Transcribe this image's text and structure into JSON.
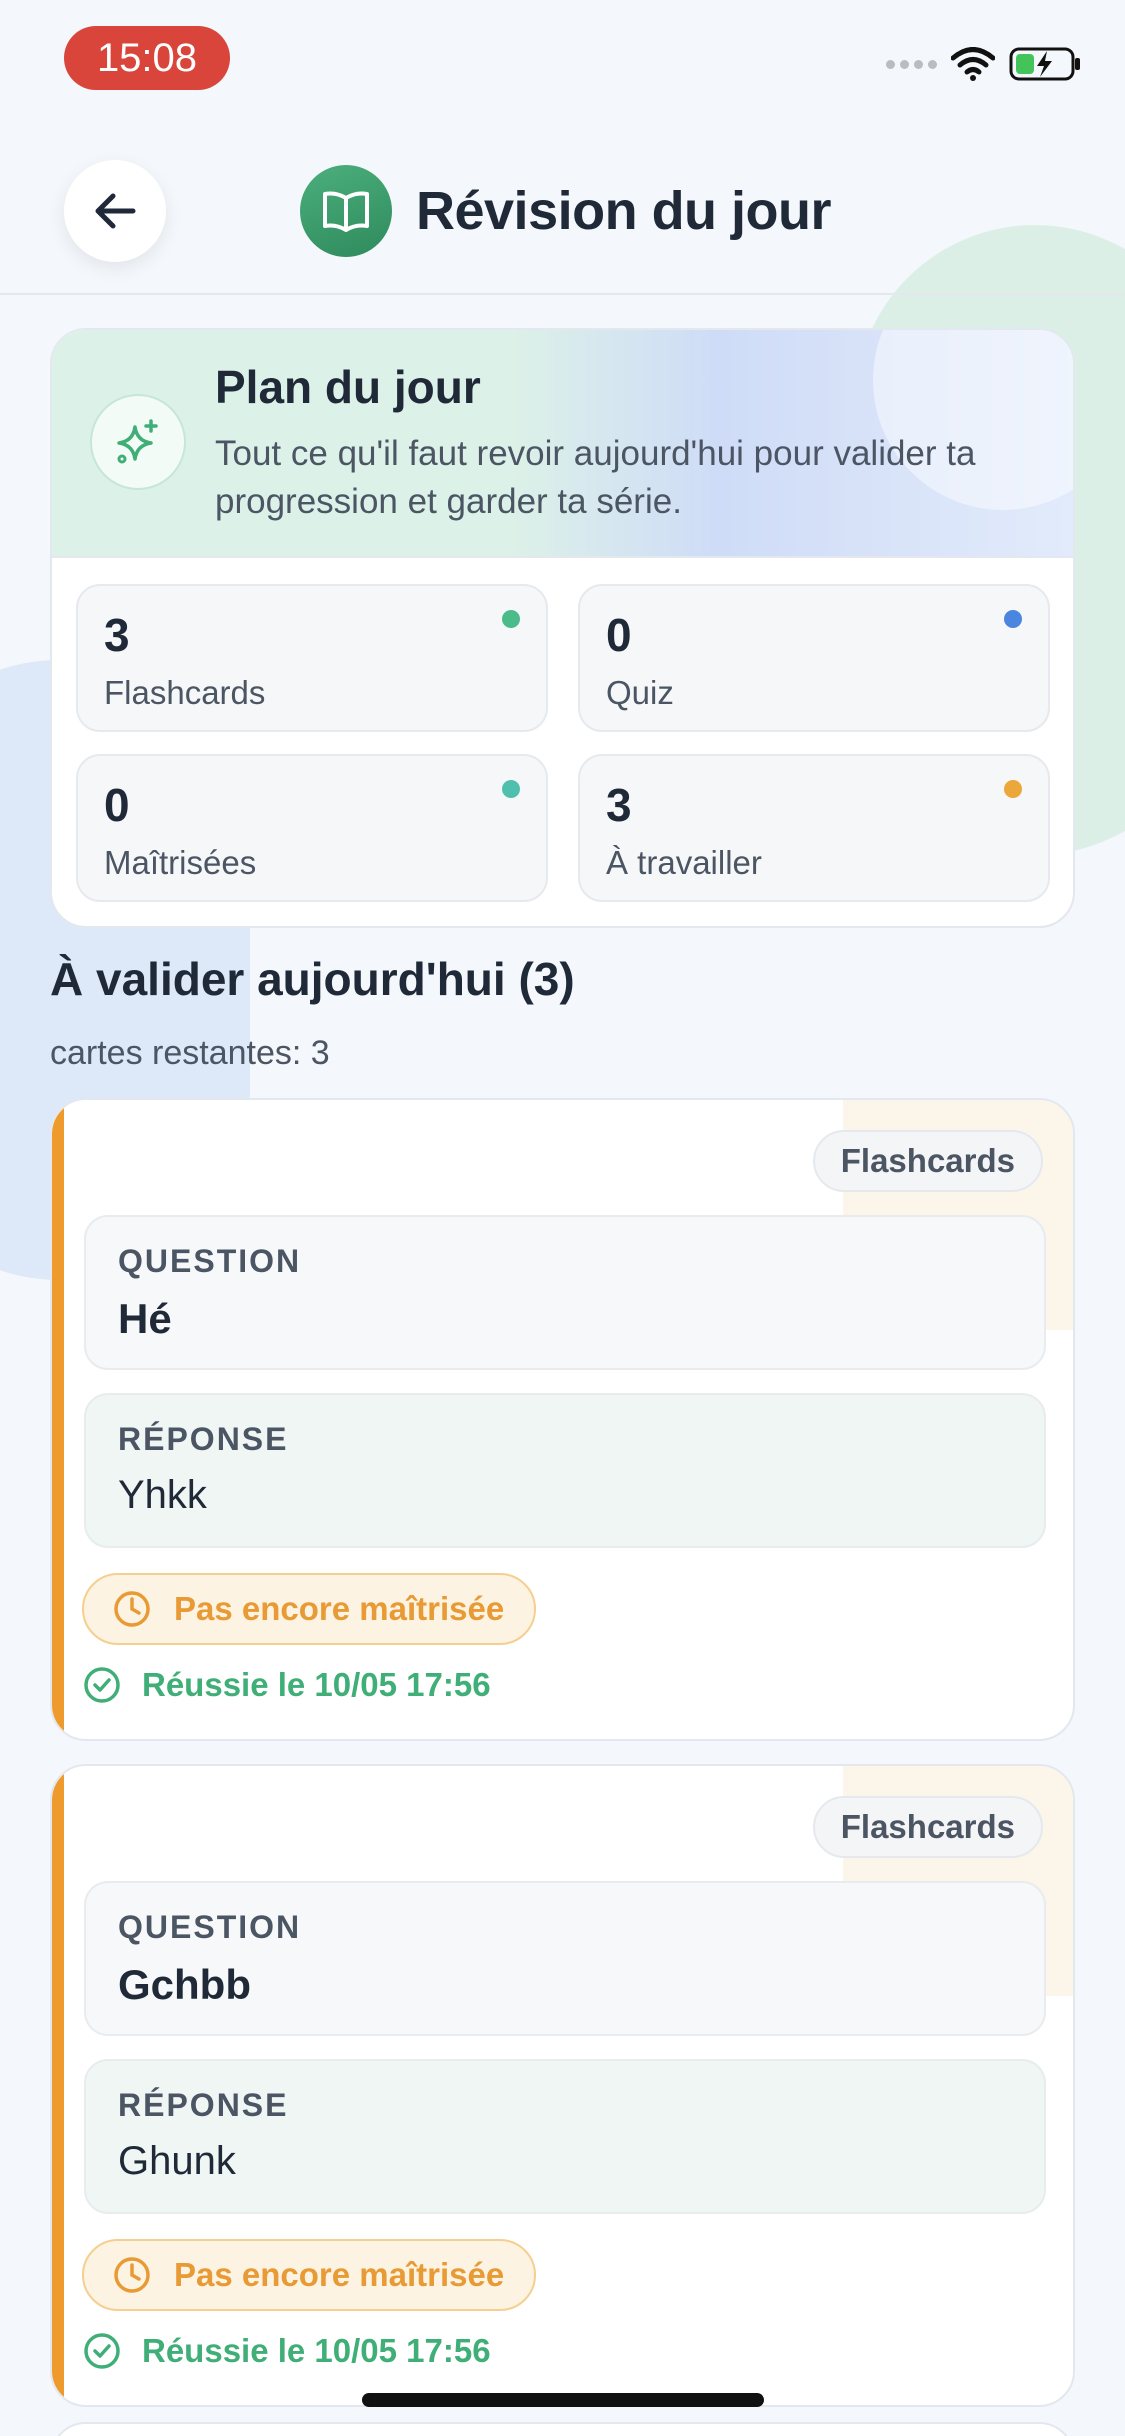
{
  "status_bar": {
    "time": "15:08"
  },
  "header": {
    "title": "Révision du jour"
  },
  "plan": {
    "title": "Plan du jour",
    "description": "Tout ce qu'il faut revoir aujourd'hui pour valider ta progression et garder ta série.",
    "stats": [
      {
        "value": "3",
        "label": "Flashcards",
        "dot_color": "#4cbb8a"
      },
      {
        "value": "0",
        "label": "Quiz",
        "dot_color": "#4a86e0"
      },
      {
        "value": "0",
        "label": "Maîtrisées",
        "dot_color": "#4fbfae"
      },
      {
        "value": "3",
        "label": "À travailler",
        "dot_color": "#eba73a"
      }
    ]
  },
  "section": {
    "title": "À valider aujourd'hui (3)",
    "subtitle": "cartes restantes: 3"
  },
  "cards": [
    {
      "type": "Flashcards",
      "question_label": "QUESTION",
      "question": "Hé",
      "answer_label": "RÉPONSE",
      "answer": "Yhkk",
      "status": "Pas encore maîtrisée",
      "success": "Réussie le 10/05 17:56"
    },
    {
      "type": "Flashcards",
      "question_label": "QUESTION",
      "question": "Gchbb",
      "answer_label": "RÉPONSE",
      "answer": "Ghunk",
      "status": "Pas encore maîtrisée",
      "success": "Réussie le 10/05 17:56"
    }
  ],
  "colors": {
    "accent_orange": "#ef9a2d",
    "success_green": "#3fae77",
    "brand_green": "#2e8a5c"
  }
}
